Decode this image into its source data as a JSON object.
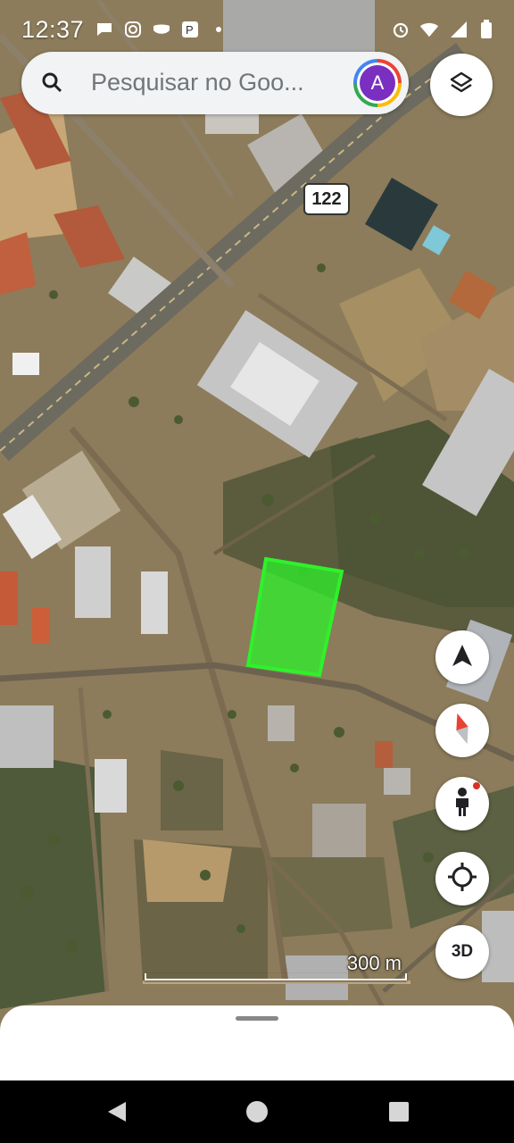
{
  "status_bar": {
    "time": "12:37",
    "left_icons": [
      "chat-icon",
      "instagram-icon",
      "mask-icon",
      "parking-icon",
      "dot-icon"
    ],
    "right_icons": [
      "alarm-icon",
      "wifi-icon",
      "signal-icon",
      "battery-icon"
    ]
  },
  "search": {
    "placeholder": "Pesquisar no Goo...",
    "avatar_letter": "A",
    "avatar_color": "#7a2fc1"
  },
  "map": {
    "route_number": "122",
    "scale_label": "300 m",
    "highlight_color": "#2ef22a"
  },
  "controls": {
    "threeD_label": "3D",
    "buttons": [
      "navigate-icon",
      "compass-icon",
      "street-view-icon",
      "my-location-icon",
      "3d-toggle"
    ]
  },
  "nav_bar": {
    "buttons": [
      "back-icon",
      "home-icon",
      "recents-icon"
    ]
  }
}
